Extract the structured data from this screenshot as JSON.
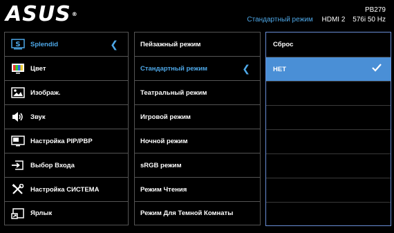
{
  "brand": {
    "logo": "ASUS",
    "trademark": "®",
    "model": "PB279"
  },
  "status": {
    "mode": "Стандартный режим",
    "input": "HDMI 2",
    "resolution": "576i 50 Hz"
  },
  "colors": {
    "accent": "#4ea8e8",
    "selected_bg": "#4a8fd6",
    "border": "#555555"
  },
  "main_menu": [
    {
      "label": "Splendid",
      "icon": "splendid-icon",
      "active": true
    },
    {
      "label": "Цвет",
      "icon": "color-icon"
    },
    {
      "label": "Изображ.",
      "icon": "image-icon"
    },
    {
      "label": "Звук",
      "icon": "speaker-icon"
    },
    {
      "label": "Настройка PIP/PBP",
      "icon": "pip-icon"
    },
    {
      "label": "Выбор Входа",
      "icon": "input-select-icon"
    },
    {
      "label": "Настройка СИСТЕМА",
      "icon": "tools-icon"
    },
    {
      "label": "Ярлык",
      "icon": "shortcut-icon"
    }
  ],
  "sub_menu": [
    {
      "label": "Пейзажный режим"
    },
    {
      "label": "Стандартный режим",
      "active": true
    },
    {
      "label": "Театральный режим"
    },
    {
      "label": "Игровой режим"
    },
    {
      "label": "Ночной режим"
    },
    {
      "label": "sRGB режим"
    },
    {
      "label": " Режим Чтения"
    },
    {
      "label": "Режим Для  Темной Комнаты"
    }
  ],
  "options": {
    "reset_label": "Сброс",
    "selected_label": "НЕТ"
  }
}
